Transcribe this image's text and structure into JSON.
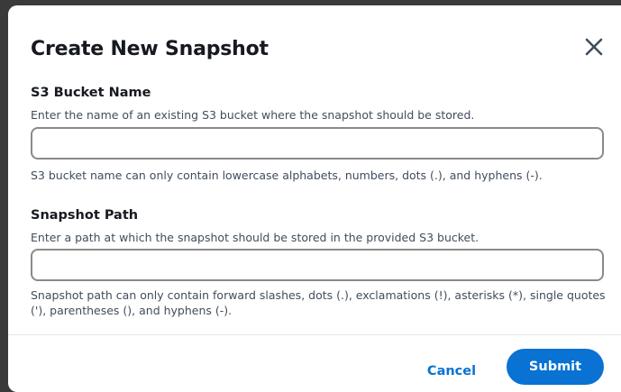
{
  "modal": {
    "title": "Create New Snapshot",
    "close_icon": "close-icon"
  },
  "bucket_field": {
    "label": "S3 Bucket Name",
    "description": "Enter the name of an existing S3 bucket where the snapshot should be stored.",
    "value": "",
    "constraint": "S3 bucket name can only contain lowercase alphabets, numbers, dots (.), and hyphens (-)."
  },
  "path_field": {
    "label": "Snapshot Path",
    "description": "Enter a path at which the snapshot should be stored in the provided S3 bucket.",
    "value": "",
    "constraint": "Snapshot path can only contain forward slashes, dots (.), exclamations (!), asterisks (*), single quotes ('), parentheses (), and hyphens (-)."
  },
  "footer": {
    "cancel_label": "Cancel",
    "submit_label": "Submit"
  },
  "colors": {
    "primary": "#0972d3",
    "text": "#16191f",
    "secondary_text": "#414d5c",
    "input_border": "#8a8a8a"
  }
}
